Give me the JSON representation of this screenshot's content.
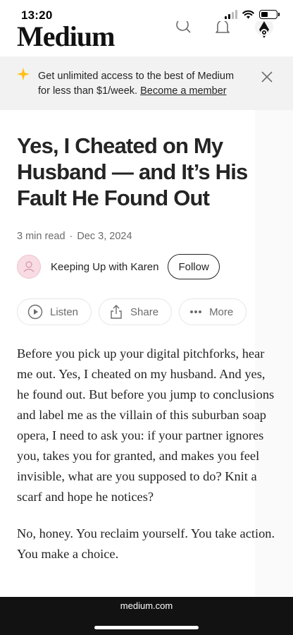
{
  "status_bar": {
    "time": "13:20"
  },
  "nav": {
    "logo": "Medium",
    "icons": [
      "search-icon",
      "bell-icon",
      "avatar-icon"
    ]
  },
  "banner": {
    "text": "Get unlimited access to the best of Medium for less than $1/week.",
    "cta": "Become a member",
    "accent": "#ffc017"
  },
  "article": {
    "title": "Yes, I Cheated on My Husband — and It’s His Fault He Found Out",
    "read_time": "3 min read",
    "separator": "·",
    "date": "Dec 3, 2024",
    "author": "Keeping Up with Karen",
    "follow_label": "Follow",
    "actions": {
      "listen": "Listen",
      "share": "Share",
      "more": "More"
    },
    "paragraphs": [
      "Before you pick up your digital pitchforks, hear me out. Yes, I cheated on my husband. And yes, he found out. But before you jump to conclusions and label me as the villain of this suburban soap opera, I need to ask you: if your partner ignores you, takes you for granted, and makes you feel invisible, what are you supposed to do? Knit a scarf and hope he notices?",
      "No, honey. You reclaim yourself. You take action. You make a choice."
    ]
  },
  "browser": {
    "url": "medium.com"
  }
}
